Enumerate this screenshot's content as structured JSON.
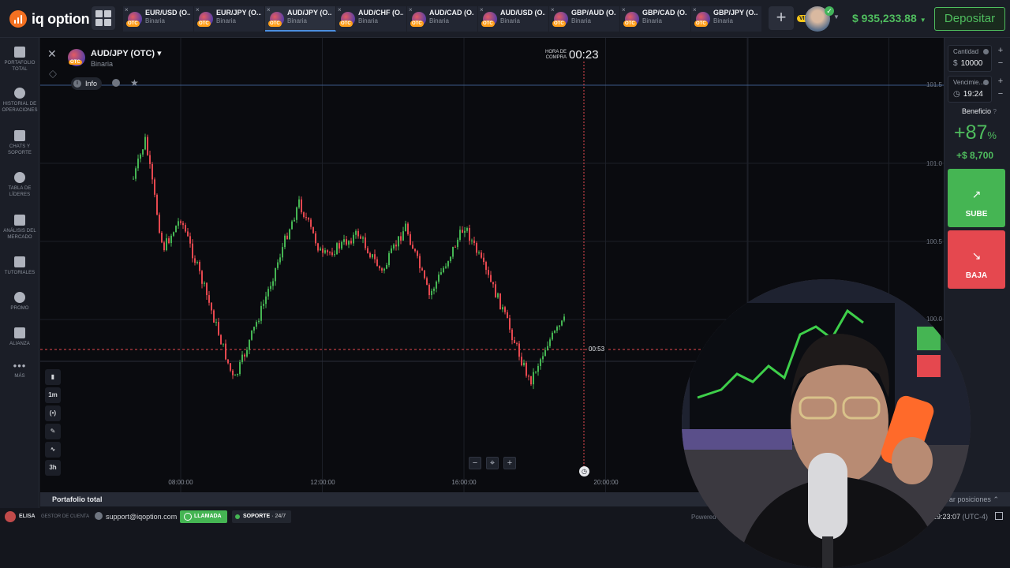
{
  "brand": {
    "name": "iq option"
  },
  "tabs": [
    {
      "symbol": "EUR/USD (O...",
      "kind": "Binaria",
      "active": false
    },
    {
      "symbol": "EUR/JPY (O...",
      "kind": "Binaria",
      "active": false
    },
    {
      "symbol": "AUD/JPY (O...",
      "kind": "Binaria",
      "active": true
    },
    {
      "symbol": "AUD/CHF (O...",
      "kind": "Binaria",
      "active": false
    },
    {
      "symbol": "AUD/CAD (O...",
      "kind": "Binaria",
      "active": false
    },
    {
      "symbol": "AUD/USD (O...",
      "kind": "Binaria",
      "active": false
    },
    {
      "symbol": "GBP/AUD (O...",
      "kind": "Binaria",
      "active": false
    },
    {
      "symbol": "GBP/CAD (O...",
      "kind": "Binaria",
      "active": false
    },
    {
      "symbol": "GBP/JPY (O...",
      "kind": "Binaria",
      "active": false
    }
  ],
  "otc_badge": "OTC",
  "account": {
    "vip": "VIP",
    "balance": "$ 935,233.88",
    "deposit_label": "Depositar"
  },
  "sidebar": [
    {
      "label": "PORTAFOLIO TOTAL",
      "icon": "briefcase-icon"
    },
    {
      "label": "HISTORIAL DE OPERACIONES",
      "icon": "history-icon"
    },
    {
      "label": "CHATS Y SOPORTE",
      "icon": "chat-icon"
    },
    {
      "label": "TABLA DE LÍDERES",
      "icon": "trophy-icon"
    },
    {
      "label": "ANÁLISIS DEL MERCADO",
      "icon": "analysis-icon"
    },
    {
      "label": "TUTORIALES",
      "icon": "graduation-icon"
    },
    {
      "label": "PROMO",
      "icon": "promo-icon"
    },
    {
      "label": "ALIANZA",
      "icon": "alliance-icon"
    },
    {
      "label": "MÁS",
      "icon": "more-icon"
    }
  ],
  "asset": {
    "name": "AUD/JPY (OTC)",
    "kind": "Binaria",
    "info_label": "Info"
  },
  "chart": {
    "buy_time_label": "HORA DE COMPRA",
    "buy_timer": "00:23",
    "expiry_countdown": "00:53",
    "timeframe": "1m",
    "period": "3h",
    "drawings_count": "2",
    "y_ticks": [
      "101.5",
      "101.0",
      "100.5",
      "100.0"
    ],
    "x_ticks": [
      "08:00:00",
      "12:00:00",
      "16:00:00",
      "20:00:00"
    ]
  },
  "chart_data": {
    "type": "candlestick",
    "title": "AUD/JPY (OTC)",
    "x_ticks": [
      "08:00:00",
      "12:00:00",
      "16:00:00",
      "20:00:00"
    ],
    "y_ticks": [
      101.5,
      101.0,
      100.5,
      100.0
    ],
    "ylim": [
      99.2,
      101.8
    ],
    "reference_lines": [
      101.5,
      100.2
    ],
    "approx_path": [
      {
        "t": "06:40",
        "price": 100.9
      },
      {
        "t": "07:00",
        "price": 101.15
      },
      {
        "t": "07:30",
        "price": 100.45
      },
      {
        "t": "08:00",
        "price": 100.65
      },
      {
        "t": "08:40",
        "price": 100.2
      },
      {
        "t": "09:30",
        "price": 99.6
      },
      {
        "t": "10:20",
        "price": 100.1
      },
      {
        "t": "11:00",
        "price": 100.55
      },
      {
        "t": "11:20",
        "price": 100.75
      },
      {
        "t": "12:00",
        "price": 100.4
      },
      {
        "t": "13:00",
        "price": 100.55
      },
      {
        "t": "13:40",
        "price": 100.3
      },
      {
        "t": "14:20",
        "price": 100.6
      },
      {
        "t": "15:00",
        "price": 100.15
      },
      {
        "t": "16:00",
        "price": 100.6
      },
      {
        "t": "17:00",
        "price": 100.1
      },
      {
        "t": "17:50",
        "price": 99.6
      },
      {
        "t": "18:20",
        "price": 99.85
      },
      {
        "t": "18:50",
        "price": 100.0
      }
    ]
  },
  "trade": {
    "amount_label": "Cantidad",
    "amount_currency": "$",
    "amount_value": "10000",
    "expiry_label": "Vencimie...",
    "expiry_value": "19:24",
    "profit_label": "Beneficio",
    "profit_pct": "+87",
    "profit_pct_unit": "%",
    "profit_amount": "+$ 8,700",
    "up_label": "SUBE",
    "down_label": "BAJA"
  },
  "portfolio": {
    "title": "Portafolio total",
    "show_positions": "strar posiciones"
  },
  "footer": {
    "user": "ELISA",
    "role": "GESTOR DE CUENTA",
    "email": "support@iqoption.com",
    "call_label": "LLAMADA",
    "support_label": "SOPORTE",
    "support_hours": "24/7",
    "powered": "Powered",
    "clock": "19:23:07",
    "timezone": "(UTC-4)"
  },
  "colors": {
    "up": "#45b553",
    "down": "#e5484f",
    "accent": "#f37021",
    "balance": "#4fbd5e"
  }
}
